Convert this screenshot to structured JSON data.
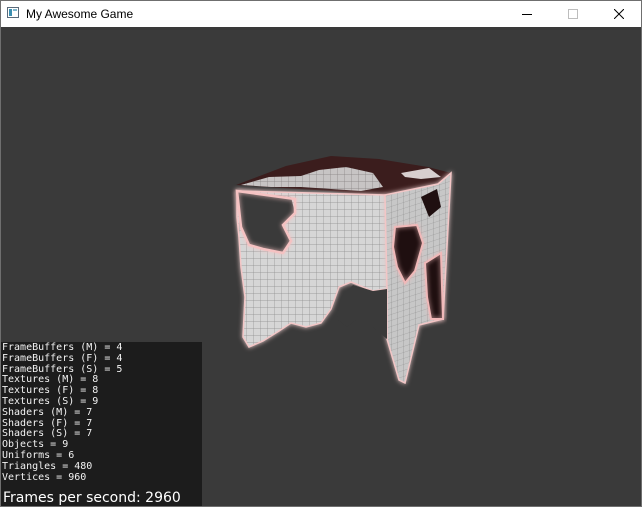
{
  "window": {
    "title": "My Awesome Game",
    "icon": "app-icon"
  },
  "controls": {
    "minimize_icon": "minimize-icon",
    "maximize_icon": "maximize-icon",
    "close_icon": "close-icon"
  },
  "scene": {
    "background_color": "#3a3a3a",
    "object": "cube",
    "glow_color": "#f0b8b8"
  },
  "stats": {
    "lines": [
      "FrameBuffers (M) = 4",
      "FrameBuffers (F) = 4",
      "FrameBuffers (S) = 5",
      "Textures (M) = 8",
      "Textures (F) = 8",
      "Textures (S) = 9",
      "Shaders (M) = 7",
      "Shaders (F) = 7",
      "Shaders (S) = 7",
      "Objects = 9",
      "Uniforms = 6",
      "Triangles = 480",
      "Vertices = 960"
    ],
    "fps_label": "Frames per second: 2960"
  }
}
